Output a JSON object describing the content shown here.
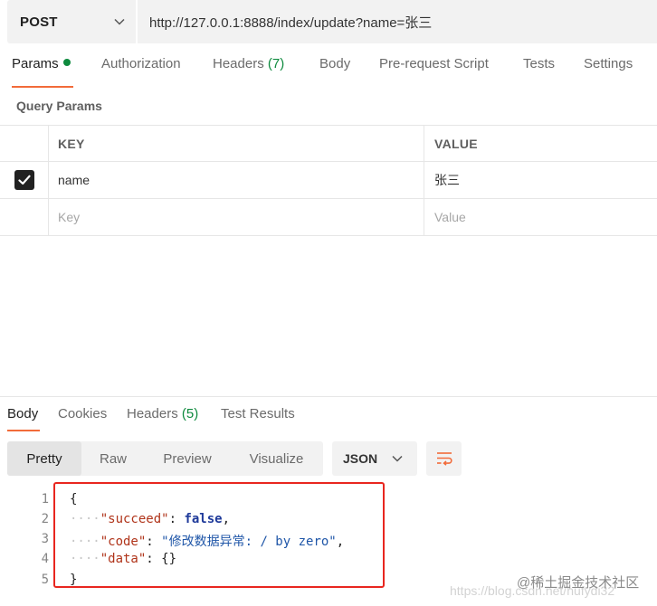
{
  "request": {
    "method": "POST",
    "url": "http://127.0.0.1:8888/index/update?name=张三"
  },
  "request_tabs": {
    "params": "Params",
    "authorization": "Authorization",
    "headers": "Headers",
    "headers_count": "(7)",
    "body": "Body",
    "prerequest": "Pre-request Script",
    "tests": "Tests",
    "settings": "Settings"
  },
  "query_params": {
    "title": "Query Params",
    "columns": {
      "key": "KEY",
      "value": "VALUE"
    },
    "rows": [
      {
        "checked": true,
        "key": "name",
        "value": "张三"
      }
    ],
    "placeholder_key": "Key",
    "placeholder_value": "Value"
  },
  "response_tabs": {
    "body": "Body",
    "cookies": "Cookies",
    "headers": "Headers",
    "headers_count": "(5)",
    "test_results": "Test Results"
  },
  "view_modes": {
    "pretty": "Pretty",
    "raw": "Raw",
    "preview": "Preview",
    "visualize": "Visualize"
  },
  "format": "JSON",
  "code": {
    "line_numbers": [
      "1",
      "2",
      "3",
      "4",
      "5"
    ],
    "open_brace": "{",
    "close_brace": "}",
    "indent": "····",
    "k_succeed": "\"succeed\"",
    "v_succeed": "false",
    "k_code": "\"code\"",
    "v_code": "\"修改数据异常: / by zero\"",
    "k_data": "\"data\"",
    "v_data": "{}",
    "colon": ": ",
    "comma": ","
  },
  "watermark": {
    "text": "@稀土掘金技术社区",
    "url": "https://blog.csdn.net/hufydi32"
  },
  "colors": {
    "accent": "#f26b3a",
    "green": "#0e8a3e",
    "highlight": "#e8261f"
  }
}
